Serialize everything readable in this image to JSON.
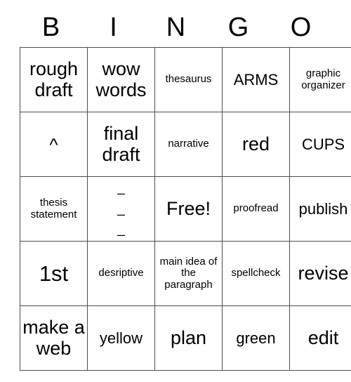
{
  "card": {
    "title": "BINGO",
    "header_letters": [
      "B",
      "I",
      "N",
      "G",
      "O"
    ],
    "free_space": "Free!",
    "rows": [
      [
        {
          "text": "rough draft",
          "size": "lg"
        },
        {
          "text": "wow words",
          "size": "lg"
        },
        {
          "text": "thesaurus",
          "size": "sm"
        },
        {
          "text": "ARMS",
          "size": "md"
        },
        {
          "text": "graphic organizer",
          "size": "sm"
        }
      ],
      [
        {
          "text": "^",
          "size": "caret"
        },
        {
          "text": "final draft",
          "size": "lg"
        },
        {
          "text": "narrative",
          "size": "sm"
        },
        {
          "text": "red",
          "size": "lg"
        },
        {
          "text": "CUPS",
          "size": "md"
        }
      ],
      [
        {
          "text": "thesis statement",
          "size": "sm"
        },
        {
          "text": "___",
          "size": "marks"
        },
        {
          "text": "Free!",
          "size": "lg"
        },
        {
          "text": "proofread",
          "size": "sm"
        },
        {
          "text": "publish",
          "size": "md"
        }
      ],
      [
        {
          "text": "1st",
          "size": "xl"
        },
        {
          "text": "desriptive",
          "size": "sm"
        },
        {
          "text": "main idea of the paragraph",
          "size": "sm"
        },
        {
          "text": "spellcheck",
          "size": "sm"
        },
        {
          "text": "revise",
          "size": "lg"
        }
      ],
      [
        {
          "text": "make a web",
          "size": "lg"
        },
        {
          "text": "yellow",
          "size": "md"
        },
        {
          "text": "plan",
          "size": "lg"
        },
        {
          "text": "green",
          "size": "md"
        },
        {
          "text": "edit",
          "size": "lg"
        }
      ]
    ],
    "marks_cell": {
      "line1": "_",
      "line2": "_",
      "line3": "_"
    }
  },
  "colors": {
    "background": "#ffffff",
    "text": "#000000",
    "border": "#4d4d4d"
  }
}
